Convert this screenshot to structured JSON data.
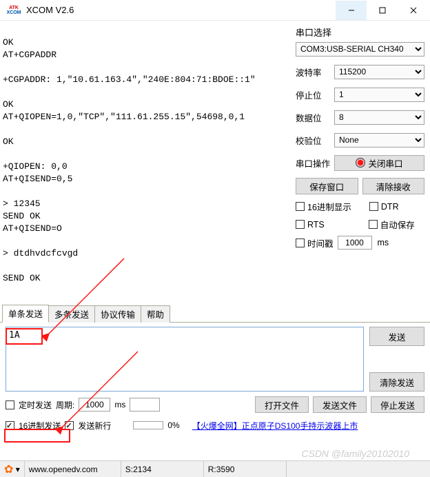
{
  "window": {
    "title": "XCOM V2.6"
  },
  "terminal": {
    "text": "\nOK\nAT+CGPADDR\n\n+CGPADDR: 1,\"10.61.163.4\",\"240E:804:71:BDOE::1\"\n\nOK\nAT+QIOPEN=1,0,\"TCP\",\"111.61.255.15\",54698,0,1\n\nOK\n\n+QIOPEN: 0,0\nAT+QISEND=0,5\n\n> 12345\nSEND OK\nAT+QISEND=O\n\n> dtdhvdcfcvgd\n\nSEND OK\n"
  },
  "sidebar": {
    "port_section_title": "串口选择",
    "port_value": "COM3:USB-SERIAL CH340",
    "baud_label": "波特率",
    "baud_value": "115200",
    "stop_label": "停止位",
    "stop_value": "1",
    "data_label": "数据位",
    "data_value": "8",
    "parity_label": "校验位",
    "parity_value": "None",
    "op_label": "串口操作",
    "close_port": "关闭串口",
    "save_window": "保存窗口",
    "clear_recv": "清除接收",
    "hex_display": "16进制显示",
    "dtr": "DTR",
    "rts": "RTS",
    "auto_save": "自动保存",
    "timestamp": "时间戳",
    "ts_value": "1000",
    "ts_unit": "ms"
  },
  "tabs": {
    "t1": "单条发送",
    "t2": "多条发送",
    "t3": "协议传输",
    "t4": "帮助"
  },
  "send": {
    "input_value": "1A ",
    "send_btn": "发送",
    "clear_btn": "清除发送",
    "timer_send": "定时发送",
    "period_label": "周期:",
    "period_value": "1000",
    "period_unit": "ms",
    "open_file": "打开文件",
    "send_file": "发送文件",
    "stop_send": "停止发送",
    "hex_send": "16进制发送",
    "send_newline": "发送新行",
    "progress": "0%",
    "link_prefix": "【火爆全网】",
    "link_text": "正点原子DS100手持示波器上市"
  },
  "status": {
    "site": "www.openedv.com",
    "s_label": "S:",
    "s_value": "2134",
    "r_label": "R:",
    "r_value": "3590"
  },
  "watermark": "CSDN @family20102010"
}
